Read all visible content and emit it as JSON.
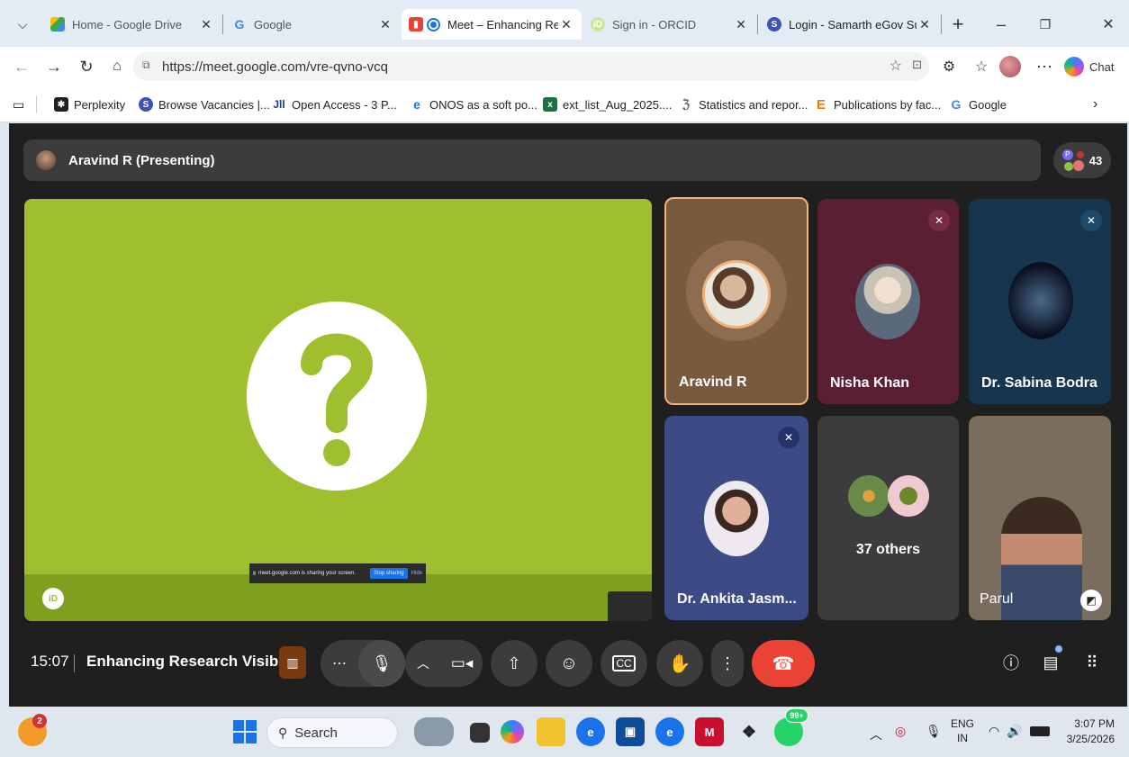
{
  "browser": {
    "tabs": [
      {
        "title": "Home - Google Drive",
        "active": false
      },
      {
        "title": "Google",
        "active": false
      },
      {
        "title": "Meet – Enhancing Rese",
        "active": true
      },
      {
        "title": "Sign in - ORCID",
        "active": false
      },
      {
        "title": "Login - Samarth eGov Suite",
        "active": false
      }
    ],
    "url_host": "https://meet.google.com",
    "url_path": "/vre-qvno-vcq",
    "chat_label": "Chat",
    "bookmarks": [
      {
        "label": "Perplexity"
      },
      {
        "label": "Browse Vacancies |..."
      },
      {
        "label": "Open Access - 3 P..."
      },
      {
        "label": "ONOS as a soft po..."
      },
      {
        "label": "ext_list_Aug_2025...."
      },
      {
        "label": "Statistics and repor..."
      },
      {
        "label": "Publications by fac..."
      },
      {
        "label": "Google"
      }
    ]
  },
  "meet": {
    "presenter_label": "Aravind R (Presenting)",
    "participant_count": "43",
    "participant_avatar_initial": "P",
    "share_notice": "meet.google.com is sharing your screen.",
    "stop_sharing_label": "Stop sharing",
    "hide_label": "Hide",
    "tiles": [
      {
        "name": "Aravind R",
        "muted": false,
        "bg": "#7a5a3f",
        "highlight": true
      },
      {
        "name": "Nisha Khan",
        "muted": true,
        "bg": "#5a1f33"
      },
      {
        "name": "Dr. Sabina Bodra",
        "muted": true,
        "bg": "#163650"
      },
      {
        "name": "Dr. Ankita Jasm...",
        "muted": true,
        "bg": "#3c4a86"
      },
      {
        "name": "37 others",
        "muted": false,
        "bg": "#3c3c3c"
      },
      {
        "name": "Parul",
        "muted": false,
        "bg": "#7a6d5e"
      }
    ],
    "time": "15:07",
    "meeting_title": "Enhancing Research Visibi...",
    "end_call_color": "#ea4335",
    "accent": "#8ab4f8"
  },
  "taskbar": {
    "notification_badge": "2",
    "search_placeholder": "Search",
    "whatsapp_badge": "99+",
    "lang_top": "ENG",
    "lang_bottom": "IN",
    "clock_time": "3:07 PM",
    "clock_date": "3/25/2026"
  }
}
